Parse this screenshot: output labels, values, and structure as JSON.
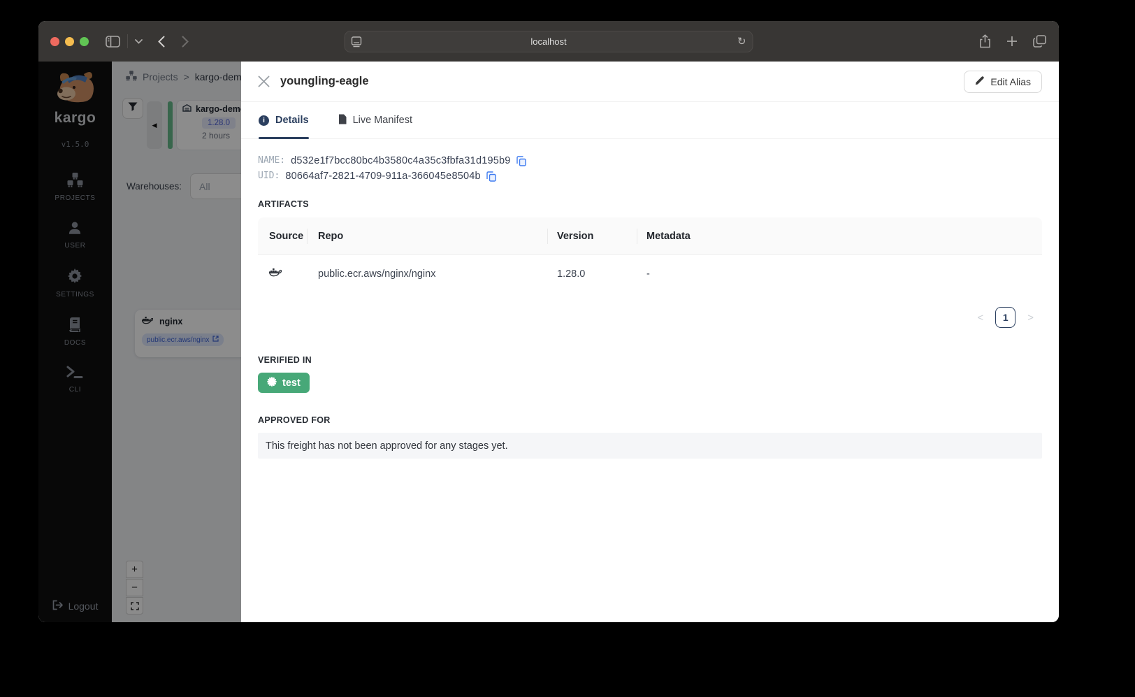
{
  "browser": {
    "url": "localhost"
  },
  "sidebar": {
    "wordmark": "kargo",
    "version": "v1.5.0",
    "items": [
      {
        "label": "PROJECTS",
        "icon": "projects-icon"
      },
      {
        "label": "USER",
        "icon": "user-icon"
      },
      {
        "label": "SETTINGS",
        "icon": "gear-icon"
      },
      {
        "label": "DOCS",
        "icon": "book-icon"
      },
      {
        "label": "CLI",
        "icon": "terminal-icon"
      }
    ],
    "logout_label": "Logout"
  },
  "canvas": {
    "breadcrumb": {
      "root": "Projects",
      "separator": ">",
      "current": "kargo-demo"
    },
    "node": {
      "name": "kargo-demo",
      "version": "1.28.0",
      "age": "2 hours"
    },
    "warehouses": {
      "label": "Warehouses:",
      "value": "All"
    },
    "image_card": {
      "title": "nginx",
      "repo": "public.ecr.aws/nginx"
    },
    "zoom": {
      "in": "+",
      "out": "−"
    }
  },
  "drawer": {
    "title": "youngling-eagle",
    "edit_alias_label": "Edit Alias",
    "tabs": [
      {
        "label": "Details",
        "active": true
      },
      {
        "label": "Live Manifest",
        "active": false
      }
    ],
    "fields": [
      {
        "label": "NAME:",
        "value": "d532e1f7bcc80bc4b3580c4a35c3fbfa31d195b9"
      },
      {
        "label": "UID:",
        "value": "80664af7-2821-4709-911a-366045e8504b"
      }
    ],
    "artifacts": {
      "heading": "ARTIFACTS",
      "columns": {
        "source": "Source",
        "repo": "Repo",
        "version": "Version",
        "metadata": "Metadata"
      },
      "rows": [
        {
          "source_icon": "docker-icon",
          "repo": "public.ecr.aws/nginx/nginx",
          "version": "1.28.0",
          "metadata": "-"
        }
      ],
      "pagination": {
        "prev": "<",
        "current": "1",
        "next": ">"
      }
    },
    "verified_in": {
      "heading": "VERIFIED IN",
      "stages": [
        {
          "name": "test",
          "color": "#47a878"
        }
      ]
    },
    "approved_for": {
      "heading": "APPROVED FOR",
      "empty_message": "This freight has not been approved for any stages yet."
    }
  },
  "colors": {
    "accent_navy": "#2b3f5f",
    "stage_green": "#47a878",
    "copy_blue": "#3e7bf0",
    "verified_green": "#66bb8a"
  }
}
